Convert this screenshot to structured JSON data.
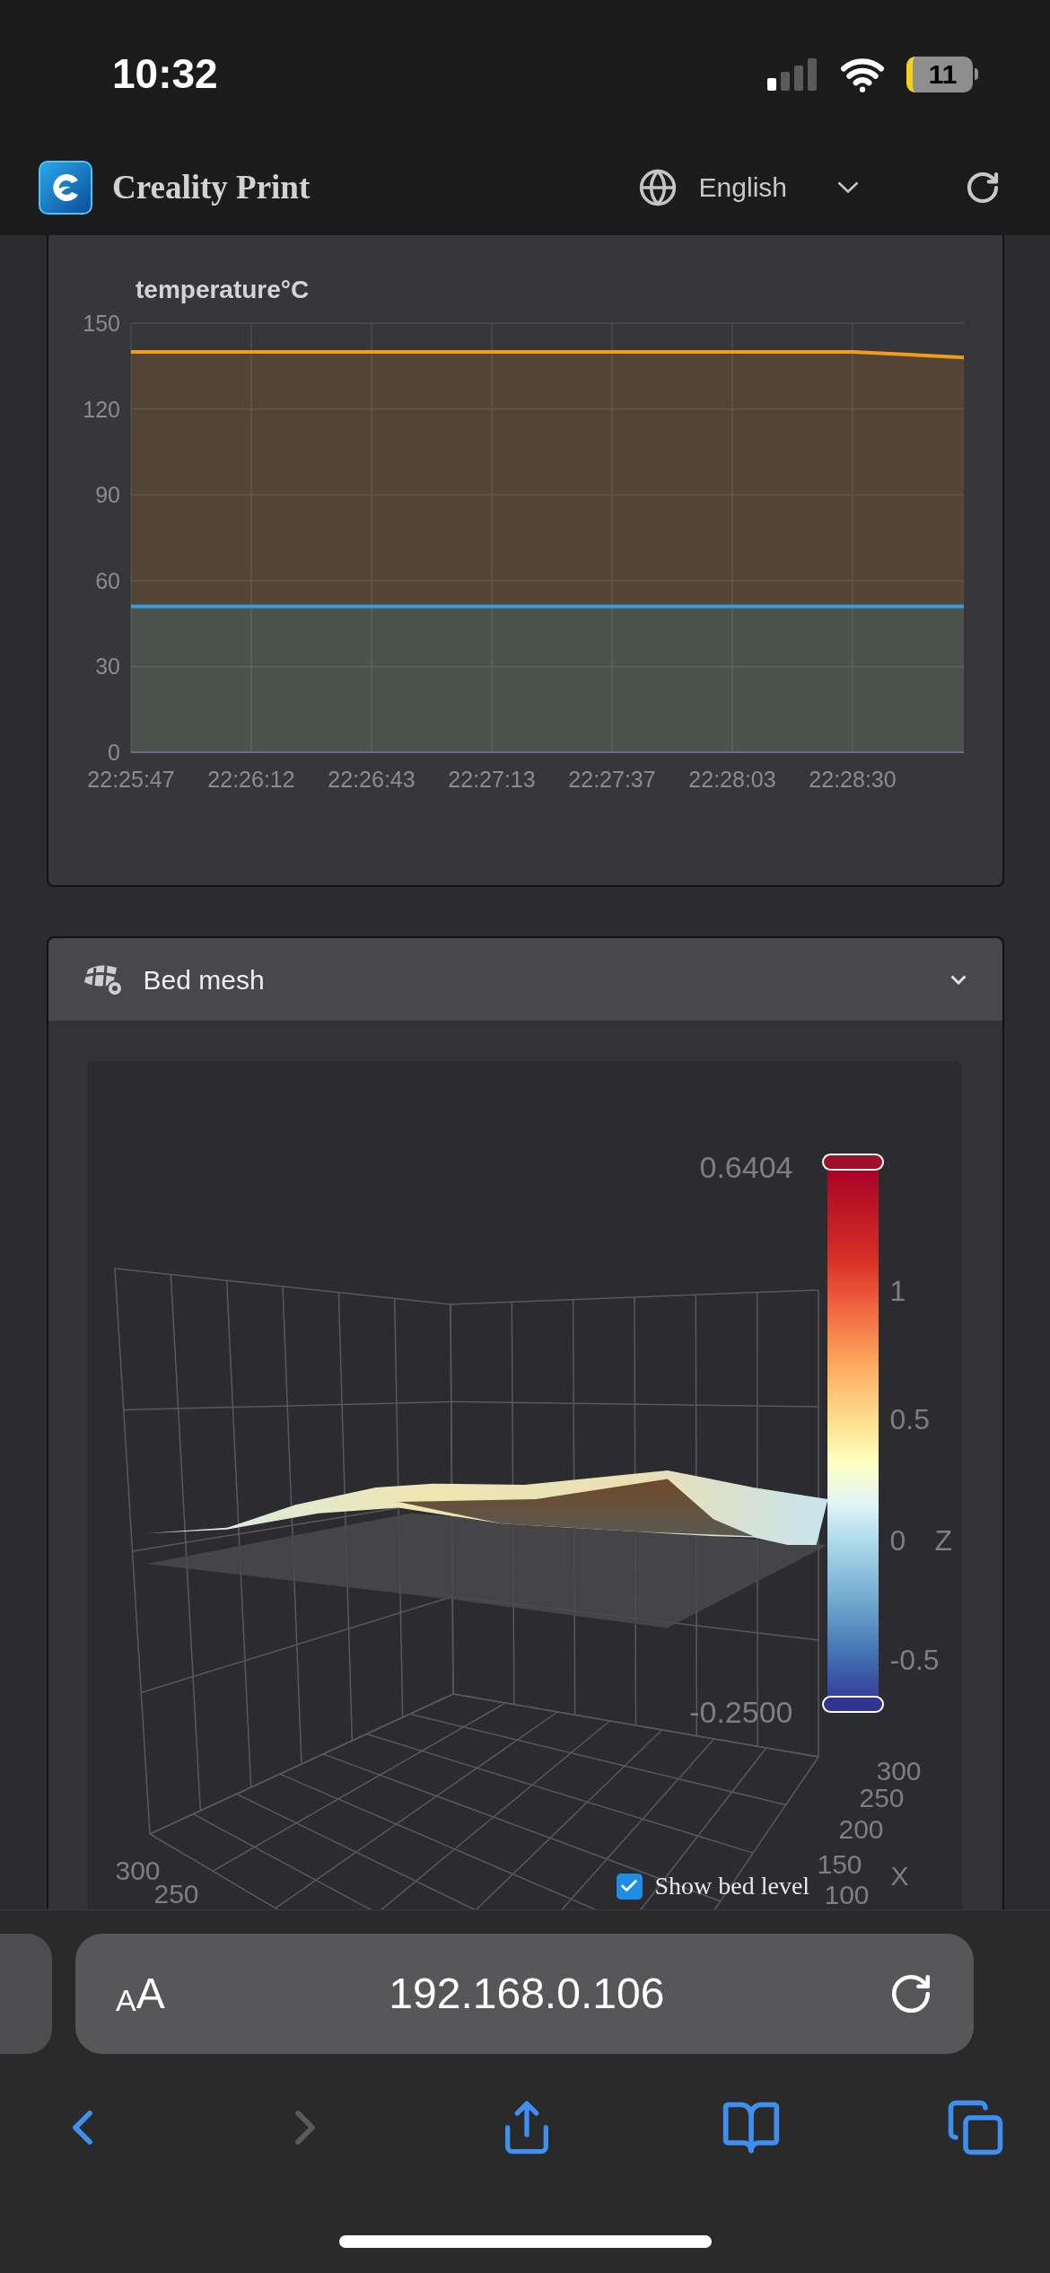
{
  "status_bar": {
    "time": "10:32",
    "battery": "11"
  },
  "header": {
    "app_name": "Creality Print",
    "language": "English"
  },
  "temperature_panel": {
    "chart_data": {
      "type": "area",
      "title": "temperature°C",
      "categories": [
        "22:25:47",
        "22:26:12",
        "22:26:43",
        "22:27:13",
        "22:27:37",
        "22:28:03",
        "22:28:30",
        null
      ],
      "series": [
        {
          "color": "#f29b1d",
          "values": [
            140,
            140,
            140,
            140,
            140,
            140,
            140,
            138
          ]
        },
        {
          "color": "#2fa0dc",
          "values": [
            51,
            51,
            51,
            51,
            51,
            51,
            51,
            51
          ]
        }
      ],
      "ylim": [
        0,
        150
      ],
      "yticks": [
        0,
        30,
        60,
        90,
        120,
        150
      ],
      "grid": true
    }
  },
  "bed_mesh": {
    "title": "Bed mesh",
    "colorbar": {
      "max_label": "0.6404",
      "min_label": "-0.2500",
      "ticks": [
        "1",
        "0.5",
        "0",
        "-0.5"
      ],
      "axis_label": "Z"
    },
    "x_axis": {
      "label": "X",
      "ticks": [
        "300",
        "250",
        "200",
        "150",
        "100"
      ]
    },
    "y_axis": {
      "ticks": [
        "300",
        "250"
      ]
    },
    "show_bed_level": {
      "label": "Show bed level",
      "checked": true
    }
  },
  "browser": {
    "text_size": "AA",
    "url": "192.168.0.106"
  }
}
